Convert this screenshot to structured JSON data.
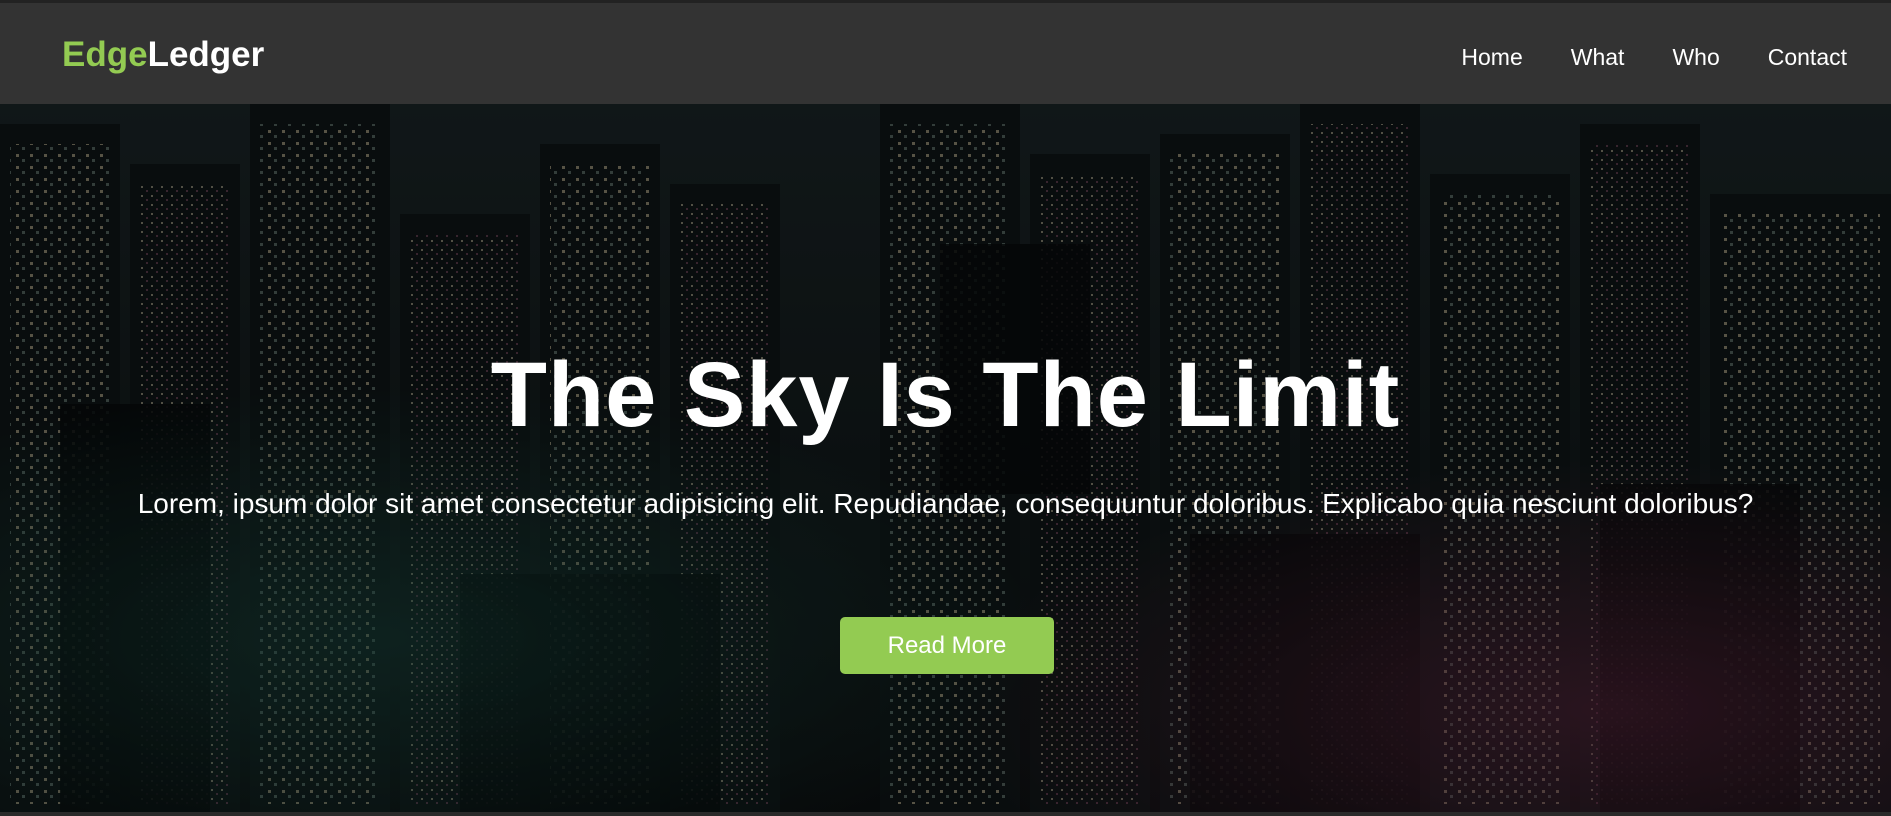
{
  "navbar": {
    "brand_accent": "Edge",
    "brand_rest": "Ledger",
    "links": [
      "Home",
      "What",
      "Who",
      "Contact"
    ]
  },
  "hero": {
    "title": "The Sky Is The Limit",
    "text": "Lorem, ipsum dolor sit amet consectetur adipisicing elit. Repudiandae, consequuntur doloribus. Explicabo quia nesciunt doloribus?",
    "button_label": "Read More",
    "background_image": "night city skyline aerial view"
  },
  "colors": {
    "navbar_bg": "#333333",
    "accent": "#93cb52",
    "text": "#ffffff"
  }
}
